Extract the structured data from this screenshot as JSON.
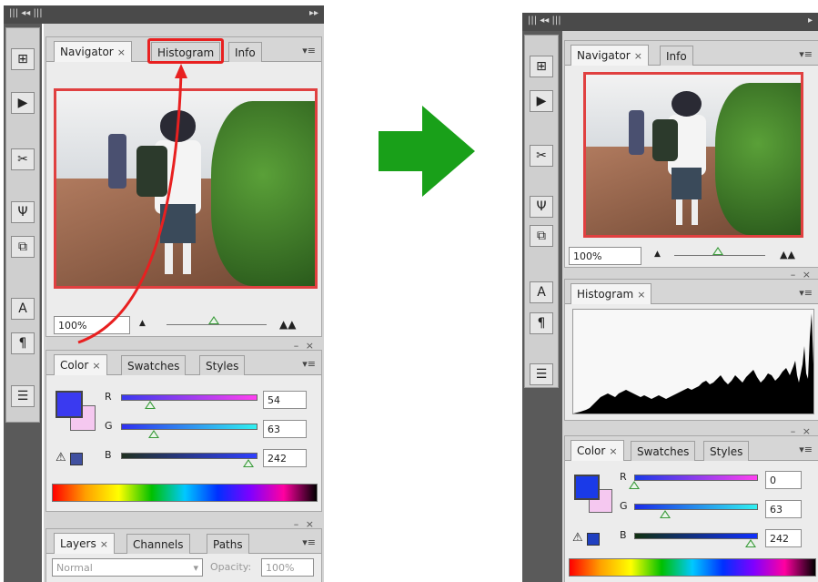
{
  "left": {
    "tabs_top": [
      {
        "label": "Navigator",
        "close": "×"
      },
      {
        "label": "Histogram",
        "close": ""
      },
      {
        "label": "Info",
        "close": ""
      }
    ],
    "zoom": "100%",
    "color_tabs": [
      {
        "label": "Color",
        "close": "×"
      },
      {
        "label": "Swatches",
        "close": ""
      },
      {
        "label": "Styles",
        "close": ""
      }
    ],
    "channels": [
      {
        "letter": "R",
        "value": "54"
      },
      {
        "letter": "G",
        "value": "63"
      },
      {
        "letter": "B",
        "value": "242"
      }
    ],
    "layers_tabs": [
      {
        "label": "Layers",
        "close": "×"
      },
      {
        "label": "Channels",
        "close": ""
      },
      {
        "label": "Paths",
        "close": ""
      }
    ],
    "blend_mode": "Normal",
    "opacity_label": "Opacity:",
    "opacity_value": "100%"
  },
  "right": {
    "tabs_top": [
      {
        "label": "Navigator",
        "close": "×"
      },
      {
        "label": "Info",
        "close": ""
      }
    ],
    "zoom": "100%",
    "histogram_tab": {
      "label": "Histogram",
      "close": "×"
    },
    "color_tabs": [
      {
        "label": "Color",
        "close": "×"
      },
      {
        "label": "Swatches",
        "close": ""
      },
      {
        "label": "Styles",
        "close": ""
      }
    ],
    "channels": [
      {
        "letter": "R",
        "value": "0"
      },
      {
        "letter": "G",
        "value": "63"
      },
      {
        "letter": "B",
        "value": "242"
      }
    ]
  },
  "colors": {
    "foreground_left": "#3a3af0",
    "background_left": "#f5c8f0",
    "foreground_right": "#1a3ae8",
    "background_right": "#f5c8f0",
    "highlight": "#e82020",
    "arrow": "#19a019"
  }
}
